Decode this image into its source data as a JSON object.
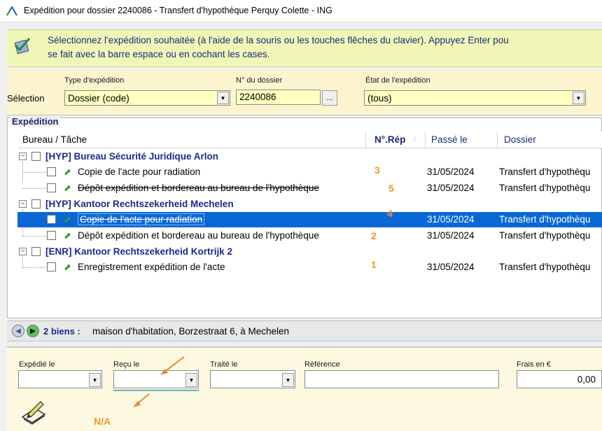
{
  "window": {
    "title": "Expédition pour dossier 2240086 - Transfert d'hypothèque Perquy Colette - ING",
    "accent": "#0a68d6"
  },
  "banner": {
    "line1": "Sélectionnez l'expédition souhaitée (à l'aide de la souris ou les touches flêches du clavier). Appuyez Enter pou",
    "line2": "se fait avec la barre espace ou en cochant les cases.",
    "background": "#f0f7b6"
  },
  "selection": {
    "label": "Sélection",
    "type_label": "Type d'expédition",
    "type_value": "Dossier (code)",
    "dossier_label": "N° du dossier",
    "dossier_value": "2240086",
    "dossier_btn": "...",
    "etat_label": "État de l'expédition",
    "etat_value": "(tous)"
  },
  "expedition": {
    "group_title": "Expédition",
    "columns": [
      "Bureau / Tâche",
      "N°.Rép",
      "Passé le",
      "Dossier"
    ],
    "groups": [
      {
        "name": "[HYP] Bureau Sécurité Juridique Arlon",
        "tasks": [
          {
            "label": "Copie de l'acte pour radiation",
            "num": "3",
            "date": "31/05/2024",
            "dossier": "Transfert d'hypothèqu",
            "struck": false,
            "selected": false
          },
          {
            "label": "Dépôt expédition et bordereau au bureau de l'hypothèque",
            "num": "5",
            "date": "31/05/2024",
            "dossier": "Transfert d'hypothèqu",
            "struck": true,
            "selected": false
          }
        ]
      },
      {
        "name": "[HYP] Kantoor Rechtszekerheid Mechelen",
        "tasks": [
          {
            "label": "Copie de l'acte pour radiation",
            "num": "4",
            "date": "31/05/2024",
            "dossier": "Transfert d'hypothèqu",
            "struck": true,
            "selected": true
          },
          {
            "label": "Dépôt expédition et bordereau au bureau de l'hypothèque",
            "num": "2",
            "date": "31/05/2024",
            "dossier": "Transfert d'hypothèqu",
            "struck": false,
            "selected": false
          }
        ]
      },
      {
        "name": "[ENR] Kantoor Rechtszekerheid Kortrijk 2",
        "tasks": [
          {
            "label": "Enregistrement expédition de l'acte",
            "num": "1",
            "date": "31/05/2024",
            "dossier": "Transfert d'hypothèqu",
            "struck": false,
            "selected": false
          }
        ]
      }
    ]
  },
  "navbar": {
    "count_label": "2 biens :",
    "address": "maison d'habitation, Borzestraat 6, à Mechelen"
  },
  "form": {
    "expedie_label": "Expédié le",
    "expedie_value": "",
    "recu_label": "Reçu le",
    "recu_value": "",
    "traite_label": "Traité le",
    "traite_value": "",
    "reference_label": "Référence",
    "reference_value": "",
    "frais_label": "Frais en €",
    "frais_value": "0,00"
  },
  "annotation": {
    "na_label": "N/A",
    "color": "#f0962e"
  }
}
